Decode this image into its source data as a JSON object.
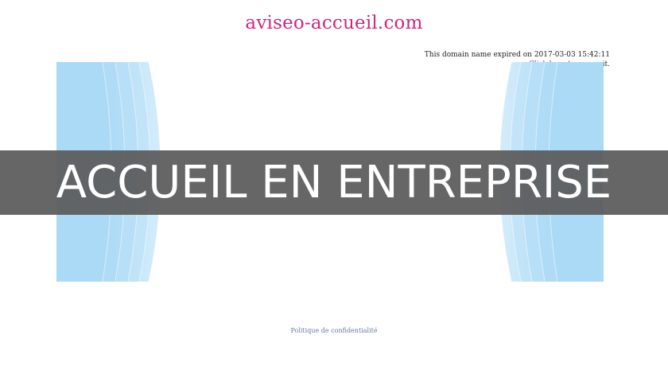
{
  "header": {
    "domain": "aviseo-accueil.com"
  },
  "notice": {
    "expired_text": "This domain name expired on 2017-03-03 15:42:11",
    "link_text": "Click here",
    "renew_suffix": " to renew it."
  },
  "banner": {
    "title": "ACCUEIL EN ENTREPRISE"
  },
  "footer": {
    "privacy_link": "Politique de confidentialité"
  },
  "colors": {
    "domain_title": "#d0257f",
    "banner_background": "#5a5a5a",
    "banner_text": "#ffffff",
    "decor_blue": "#b3dcf5"
  }
}
